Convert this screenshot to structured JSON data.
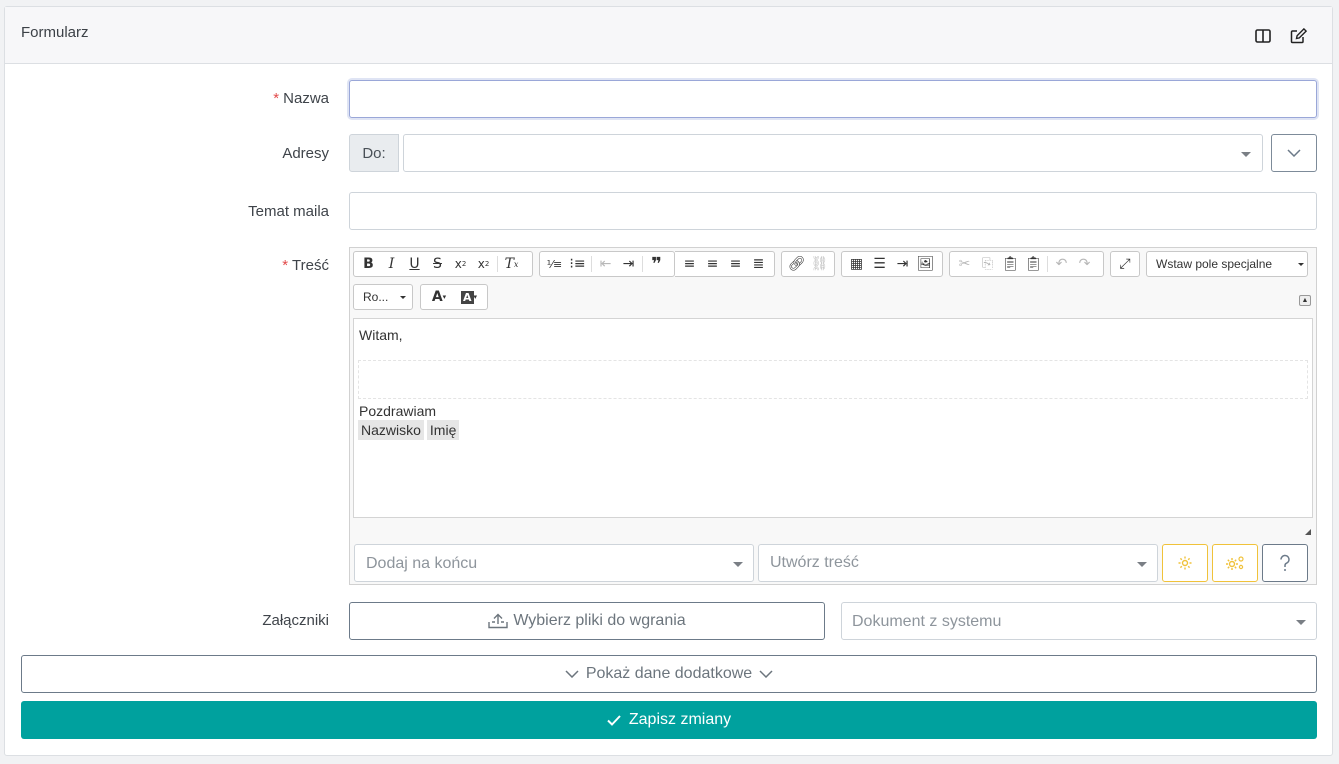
{
  "header": {
    "title": "Formularz",
    "icons": [
      "columns-icon",
      "edit-icon"
    ]
  },
  "form": {
    "name": {
      "label": "Nazwa",
      "required_mark": "*",
      "value": ""
    },
    "addresses": {
      "label": "Adresy",
      "prefix": "Do:",
      "value": ""
    },
    "subject": {
      "label": "Temat maila",
      "value": ""
    },
    "body": {
      "label": "Treść",
      "required_mark": "*",
      "font_select": "Ro...",
      "special_field_select": "Wstaw pole specjalne",
      "content": {
        "greeting": "Witam,",
        "closing": "Pozdrawiam",
        "fields": [
          "Nazwisko",
          "Imię"
        ]
      },
      "append_select_placeholder": "Dodaj na końcu",
      "create_select_placeholder": "Utwórz treść"
    },
    "attachments": {
      "label": "Załączniki",
      "upload_button": "Wybierz pliki do wgrania",
      "system_doc_placeholder": "Dokument z systemu"
    }
  },
  "actions": {
    "show_more": "Pokaż dane dodatkowe",
    "save": "Zapisz zmiany"
  },
  "colors": {
    "primary": "#00a19e",
    "warning": "#f0c23a",
    "required": "#e24a4a"
  }
}
